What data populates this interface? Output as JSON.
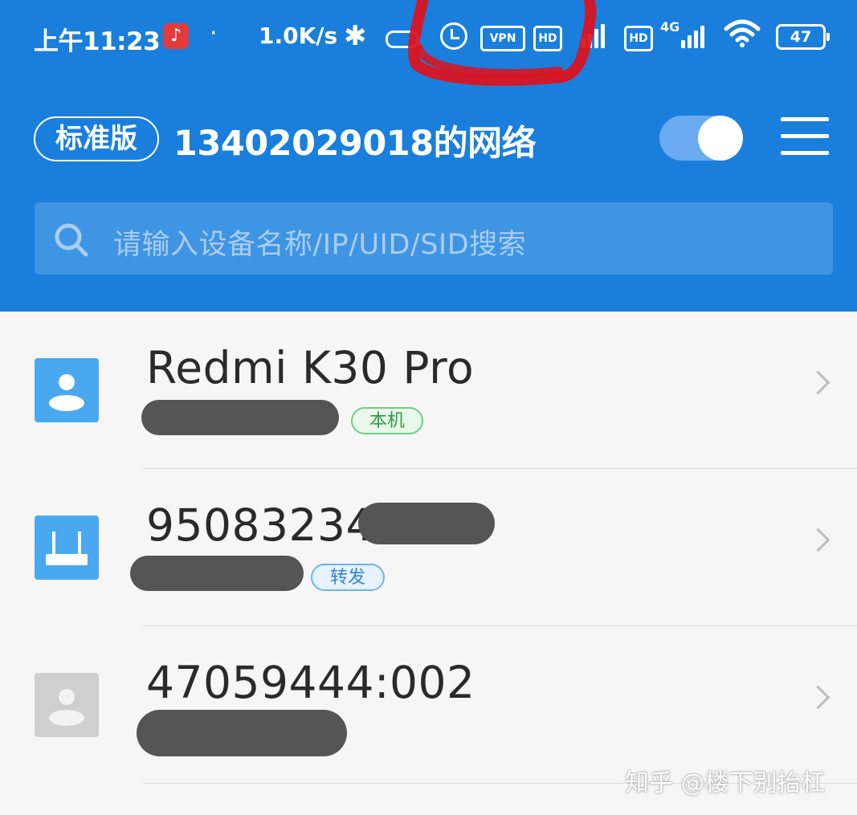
{
  "status_bar": {
    "time": "上午11:23",
    "dot": "·",
    "net_speed": "1.0K/s",
    "vpn": "VPN",
    "hd1": "HD",
    "hd2": "HD",
    "network_type": "4G",
    "battery": "47",
    "icons": [
      "netease-music-icon",
      "bluetooth-icon",
      "capsule-icon",
      "alarm-icon",
      "vpn-icon",
      "hd-icon",
      "signal-icon",
      "wifi-icon",
      "battery-icon"
    ]
  },
  "header": {
    "edition_badge": "标准版",
    "network_title": "13402029018的网络",
    "toggle_on": true
  },
  "search": {
    "placeholder": "请输入设备名称/IP/UID/SID搜索"
  },
  "devices": [
    {
      "name": "Redmi K30 Pro",
      "tag": "本机",
      "icon": "user-icon",
      "status": "online"
    },
    {
      "name": "95083234",
      "tag": "转发",
      "icon": "router-icon",
      "status": "online"
    },
    {
      "name": "47059444:002",
      "tag": "",
      "icon": "user-icon",
      "status": "offline"
    }
  ],
  "watermark": "知乎 @楼下别抬杠",
  "colors": {
    "header_bg": "#1a7fdc",
    "search_bg": "#3f95e3",
    "online_icon": "#4aa8f0",
    "offline_icon": "#cfcfcf",
    "tag_local": "#2e9a46",
    "tag_relay": "#2f86d6",
    "annotation_scribble": "#e0101a"
  }
}
